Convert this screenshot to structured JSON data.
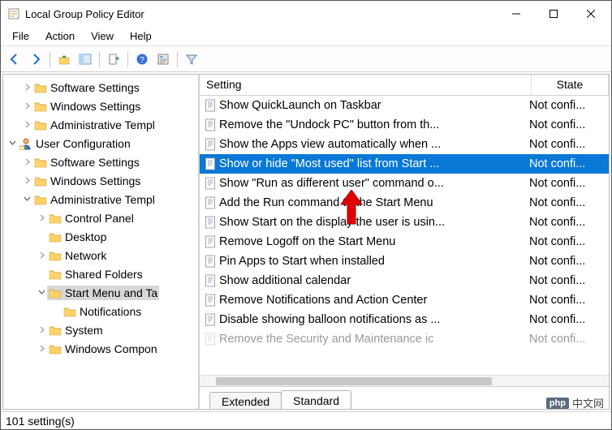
{
  "window": {
    "title": "Local Group Policy Editor"
  },
  "menubar": [
    "File",
    "Action",
    "View",
    "Help"
  ],
  "tree": [
    {
      "indent": 1,
      "twisty": ">",
      "icon": "folder",
      "label": "Software Settings"
    },
    {
      "indent": 1,
      "twisty": ">",
      "icon": "folder",
      "label": "Windows Settings"
    },
    {
      "indent": 1,
      "twisty": ">",
      "icon": "folder",
      "label": "Administrative Templ"
    },
    {
      "indent": 0,
      "twisty": "v",
      "icon": "user",
      "label": "User Configuration"
    },
    {
      "indent": 1,
      "twisty": ">",
      "icon": "folder",
      "label": "Software Settings"
    },
    {
      "indent": 1,
      "twisty": ">",
      "icon": "folder",
      "label": "Windows Settings"
    },
    {
      "indent": 1,
      "twisty": "v",
      "icon": "folder",
      "label": "Administrative Templ"
    },
    {
      "indent": 2,
      "twisty": ">",
      "icon": "folder",
      "label": "Control Panel"
    },
    {
      "indent": 2,
      "twisty": "",
      "icon": "folder",
      "label": "Desktop"
    },
    {
      "indent": 2,
      "twisty": ">",
      "icon": "folder",
      "label": "Network"
    },
    {
      "indent": 2,
      "twisty": "",
      "icon": "folder",
      "label": "Shared Folders"
    },
    {
      "indent": 2,
      "twisty": "v",
      "icon": "folder",
      "label": "Start Menu and Ta",
      "selected": true
    },
    {
      "indent": 3,
      "twisty": "",
      "icon": "folder",
      "label": "Notifications"
    },
    {
      "indent": 2,
      "twisty": ">",
      "icon": "folder",
      "label": "System"
    },
    {
      "indent": 2,
      "twisty": ">",
      "icon": "folder",
      "label": "Windows Compon"
    }
  ],
  "columns": {
    "setting": "Setting",
    "state": "State"
  },
  "rows": [
    {
      "setting": "Show QuickLaunch on Taskbar",
      "state": "Not confi..."
    },
    {
      "setting": "Remove the \"Undock PC\" button from th...",
      "state": "Not confi..."
    },
    {
      "setting": "Show the Apps view automatically when ...",
      "state": "Not confi..."
    },
    {
      "setting": "Show or hide \"Most used\" list from Start ...",
      "state": "Not confi...",
      "selected": true
    },
    {
      "setting": "Show \"Run as different user\" command o...",
      "state": "Not confi..."
    },
    {
      "setting": "Add the Run command to the Start Menu",
      "state": "Not confi..."
    },
    {
      "setting": "Show Start on the display the user is usin...",
      "state": "Not confi..."
    },
    {
      "setting": "Remove Logoff on the Start Menu",
      "state": "Not confi..."
    },
    {
      "setting": "Pin Apps to Start when installed",
      "state": "Not confi..."
    },
    {
      "setting": "Show additional calendar",
      "state": "Not confi..."
    },
    {
      "setting": "Remove Notifications and Action Center",
      "state": "Not confi..."
    },
    {
      "setting": "Disable showing balloon notifications as ...",
      "state": "Not confi..."
    },
    {
      "setting": "Remove the Security and Maintenance ic",
      "state": "Not confi..."
    }
  ],
  "tabs": {
    "extended": "Extended",
    "standard": "Standard"
  },
  "statusbar": "101 setting(s)",
  "watermark": {
    "badge": "php",
    "text": "中文网"
  }
}
